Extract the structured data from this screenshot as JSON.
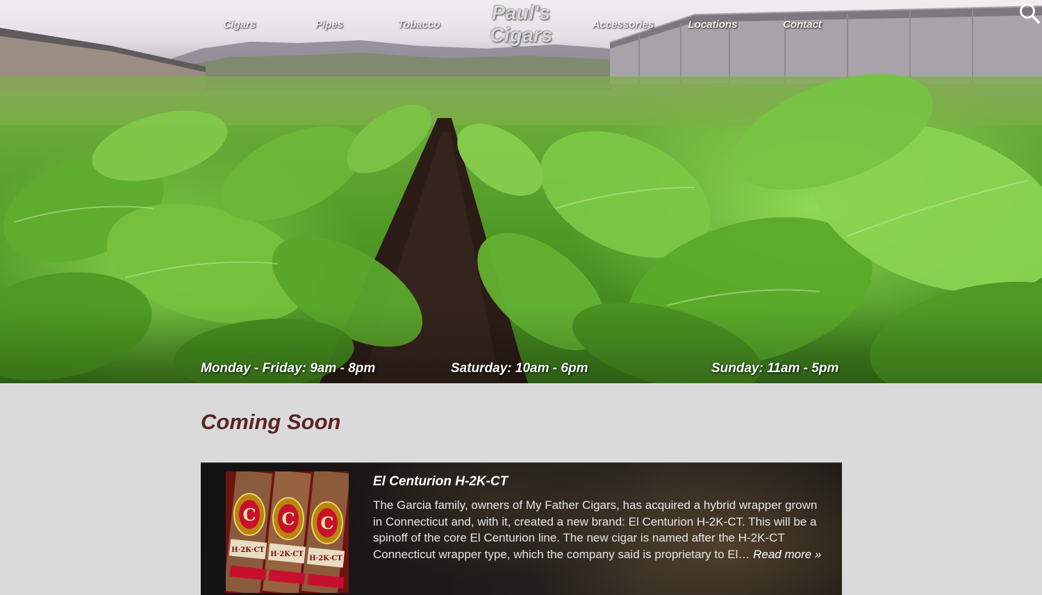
{
  "nav": {
    "items": [
      {
        "label": "Cigars"
      },
      {
        "label": "Pipes"
      },
      {
        "label": "Tobacco"
      },
      {
        "label": "Accessories"
      },
      {
        "label": "Locations"
      },
      {
        "label": "Contact"
      }
    ],
    "logo": {
      "line1": "Paul's",
      "line2": "Cigars"
    }
  },
  "icons": {
    "search": "search-icon"
  },
  "hours": {
    "weekday": "Monday - Friday: 9am - 8pm",
    "saturday": "Saturday: 10am - 6pm",
    "sunday": "Sunday: 11am - 5pm"
  },
  "section": {
    "title": "Coming Soon"
  },
  "article": {
    "title": "El Centurion H-2K-CT",
    "body": "The Garcia family, owners of My Father Cigars, has acquired a hybrid wrapper grown in Connecticut and, with it, created a new brand: El Centurion H-2K-CT. This will be a spinoff of the core El Centurion line. The new cigar is named after the H-2K-CT Connecticut wrapper type, which the company said is proprietary to El…",
    "read_more": "Read more »",
    "image_band_text": "H·2K·CT",
    "image_seal_letter": "C"
  },
  "colors": {
    "title_accent": "#5b2424",
    "page_background": "#dadada",
    "card_background": "#1a1816"
  }
}
